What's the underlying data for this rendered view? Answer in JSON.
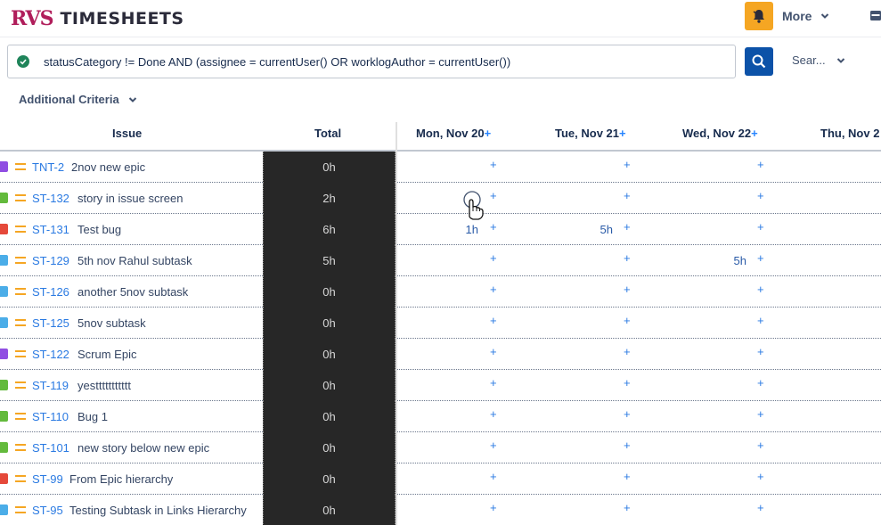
{
  "app": {
    "logo_text": "RVS",
    "title": "TIMESHEETS",
    "more_label": "More"
  },
  "search": {
    "jql": "statusCategory != Done AND (assignee = currentUser() OR  worklogAuthor = currentUser())",
    "saved_label": "Sear...",
    "criteria_label": "Additional Criteria"
  },
  "grid": {
    "columns": {
      "issue": "Issue",
      "total": "Total",
      "days": [
        {
          "label": "Mon, Nov 20",
          "plus": "+"
        },
        {
          "label": "Tue, Nov 21",
          "plus": "+"
        },
        {
          "label": "Wed, Nov 22",
          "plus": "+"
        },
        {
          "label": "Thu, Nov 2",
          "plus": ""
        }
      ]
    },
    "cell_plus": "+",
    "rows": [
      {
        "type": "epic",
        "key": "TNT-2",
        "summary": "2nov new epic",
        "total": "0h",
        "mon": "",
        "tue": "",
        "wed": ""
      },
      {
        "type": "story",
        "key": "ST-132",
        "summary": "story in issue screen",
        "total": "2h",
        "mon": "",
        "tue": "",
        "wed": ""
      },
      {
        "type": "bug",
        "key": "ST-131",
        "summary": "Test bug",
        "total": "6h",
        "mon": "1h",
        "tue": "5h",
        "wed": ""
      },
      {
        "type": "subtask",
        "key": "ST-129",
        "summary": "5th nov Rahul subtask",
        "total": "5h",
        "mon": "",
        "tue": "",
        "wed": "5h"
      },
      {
        "type": "subtask",
        "key": "ST-126",
        "summary": "another 5nov subtask",
        "total": "0h",
        "mon": "",
        "tue": "",
        "wed": ""
      },
      {
        "type": "subtask",
        "key": "ST-125",
        "summary": "5nov subtask",
        "total": "0h",
        "mon": "",
        "tue": "",
        "wed": ""
      },
      {
        "type": "epic",
        "key": "ST-122",
        "summary": "Scrum Epic",
        "total": "0h",
        "mon": "",
        "tue": "",
        "wed": ""
      },
      {
        "type": "story",
        "key": "ST-119",
        "summary": "yesttttttttttt",
        "total": "0h",
        "mon": "",
        "tue": "",
        "wed": ""
      },
      {
        "type": "story",
        "key": "ST-110",
        "summary": "Bug 1",
        "total": "0h",
        "mon": "",
        "tue": "",
        "wed": ""
      },
      {
        "type": "story",
        "key": "ST-101",
        "summary": "new story below new epic",
        "total": "0h",
        "mon": "",
        "tue": "",
        "wed": ""
      },
      {
        "type": "bug",
        "key": "ST-99",
        "summary": "From Epic hierarchy",
        "total": "0h",
        "mon": "",
        "tue": "",
        "wed": ""
      },
      {
        "type": "subtask",
        "key": "ST-95",
        "summary": "Testing Subtask in Links Hierarchy",
        "total": "0h",
        "mon": "",
        "tue": "",
        "wed": ""
      }
    ]
  },
  "colors": {
    "epic": "#904ee2",
    "story": "#63ba3c",
    "bug": "#e5493a",
    "subtask": "#4bade8",
    "priority": "#f5a623",
    "accent": "#0c52a8",
    "link": "#2a7ae2"
  },
  "icons": {
    "check": "check-circle-icon",
    "bell": "bell-icon",
    "search": "search-icon",
    "chevron": "chevron-down-icon",
    "calendar": "calendar-icon",
    "priority": "priority-medium-icon"
  }
}
